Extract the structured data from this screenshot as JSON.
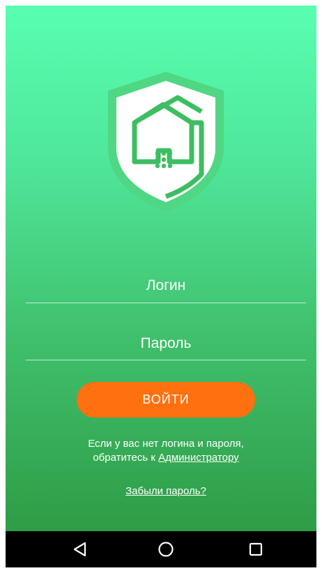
{
  "colors": {
    "gradient_top": "#58ffb0",
    "gradient_bottom": "#2f9c46",
    "accent_button": "#ff7010",
    "text": "#ffffff",
    "navbar": "#000000"
  },
  "logo": {
    "icon": "shield-house-icon"
  },
  "form": {
    "login_placeholder": "Логин",
    "password_placeholder": "Пароль",
    "submit_label": "ВОЙТИ"
  },
  "info": {
    "line1": "Если у вас нет логина и пароля,",
    "line2_prefix": "обратитесь к ",
    "admin_link": "Администратору"
  },
  "forgot_password_link": "Забыли пароль?",
  "navbar": {
    "back_icon": "back-triangle-icon",
    "home_icon": "home-circle-icon",
    "recents_icon": "recents-square-icon"
  }
}
